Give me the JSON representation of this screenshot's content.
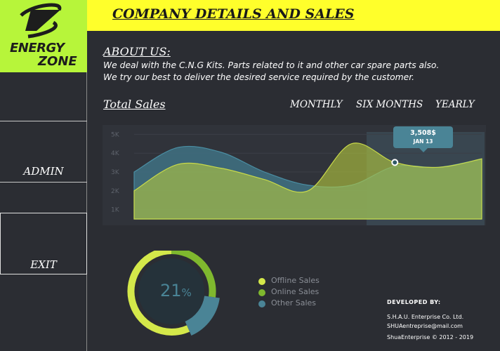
{
  "logo": {
    "line1": "ENERGY",
    "line2": "ZONE"
  },
  "sidebar": {
    "admin_label": "ADMIN",
    "exit_label": "EXIT"
  },
  "header": {
    "title": "COMPANY DETAILS AND SALES"
  },
  "about": {
    "title": "ABOUT US:",
    "line1": "We deal with the C.N.G Kits. Parts related to it and other car spare parts also.",
    "line2": "We try our best to deliver the desired service required by the customer."
  },
  "sales": {
    "title": "Total Sales",
    "periods": [
      "MONTHLY",
      "SIX MONTHS",
      "YEARLY"
    ]
  },
  "tooltip": {
    "value": "3,508$",
    "date": "JAN 13"
  },
  "colors": {
    "accent_yellow": "#ffff2b",
    "logo_green": "#b7f53a",
    "offline": "#d4e84a",
    "online": "#7fb82e",
    "other": "#4a8496"
  },
  "chart_data": {
    "type": "area",
    "y_ticks": [
      "5K",
      "4K",
      "3K",
      "2K",
      "1K"
    ],
    "ylim": [
      500,
      5500
    ],
    "series": [
      {
        "values": [
          3000,
          4300,
          4050,
          3000,
          2300,
          2300,
          3300,
          3250,
          3700
        ]
      },
      {
        "values": [
          2000,
          3400,
          3200,
          2600,
          2000,
          4500,
          3508,
          3250,
          3700
        ]
      }
    ],
    "highlight": {
      "index": 6,
      "value": 3508
    }
  },
  "donut": {
    "value": "21",
    "unit": "%"
  },
  "legend": [
    "Offline Sales",
    "Online Sales",
    "Other Sales"
  ],
  "developer": {
    "title": "DEVELOPED BY:",
    "company": "S.H.A.U. Enterprise Co. Ltd.",
    "email": "SHUAentreprise@mail.com",
    "copyright": "ShuaEnterprise © 2012 - 2019"
  }
}
